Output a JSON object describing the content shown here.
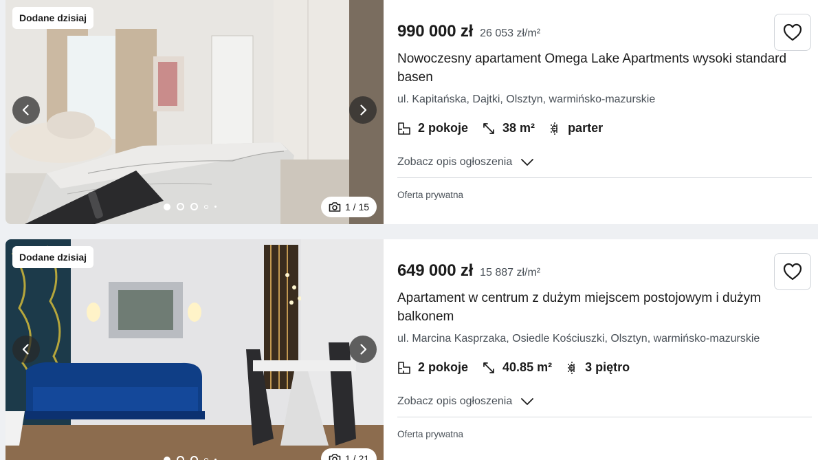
{
  "listings": [
    {
      "badge": "Dodane dzisiaj",
      "price": "990 000 zł",
      "price_per_m2": "26 053 zł/m²",
      "title": "Nowoczesny apartament Omega Lake Apartments wysoki standard basen",
      "address": "ul. Kapitańska, Dajtki, Olsztyn, warmińsko-mazurskie",
      "rooms": "2 pokoje",
      "area": "38 m²",
      "floor": "parter",
      "description_toggle": "Zobacz opis ogłoszenia",
      "seller_type": "Oferta prywatna",
      "photo_counter": "1 / 15",
      "icons": {
        "prev": "chevron-left-icon",
        "next": "chevron-right-icon",
        "camera": "camera-icon",
        "favorite": "heart-icon"
      }
    },
    {
      "badge": "Dodane dzisiaj",
      "price": "649 000 zł",
      "price_per_m2": "15 887 zł/m²",
      "title": "Apartament w centrum z dużym miejscem postojowym i dużym balkonem",
      "address": "ul. Marcina Kasprzaka, Osiedle Kościuszki, Olsztyn, warmińsko-mazurskie",
      "rooms": "2 pokoje",
      "area": "40.85 m²",
      "floor": "3 piętro",
      "description_toggle": "Zobacz opis ogłoszenia",
      "seller_type": "Oferta prywatna",
      "photo_counter": "1 / 21",
      "icons": {
        "prev": "chevron-left-icon",
        "next": "chevron-right-icon",
        "camera": "camera-icon",
        "favorite": "heart-icon"
      }
    }
  ],
  "colors": {
    "page_bg": "#eef0f3",
    "card_bg": "#ffffff",
    "text": "#1b1b1b",
    "muted": "#495057"
  }
}
